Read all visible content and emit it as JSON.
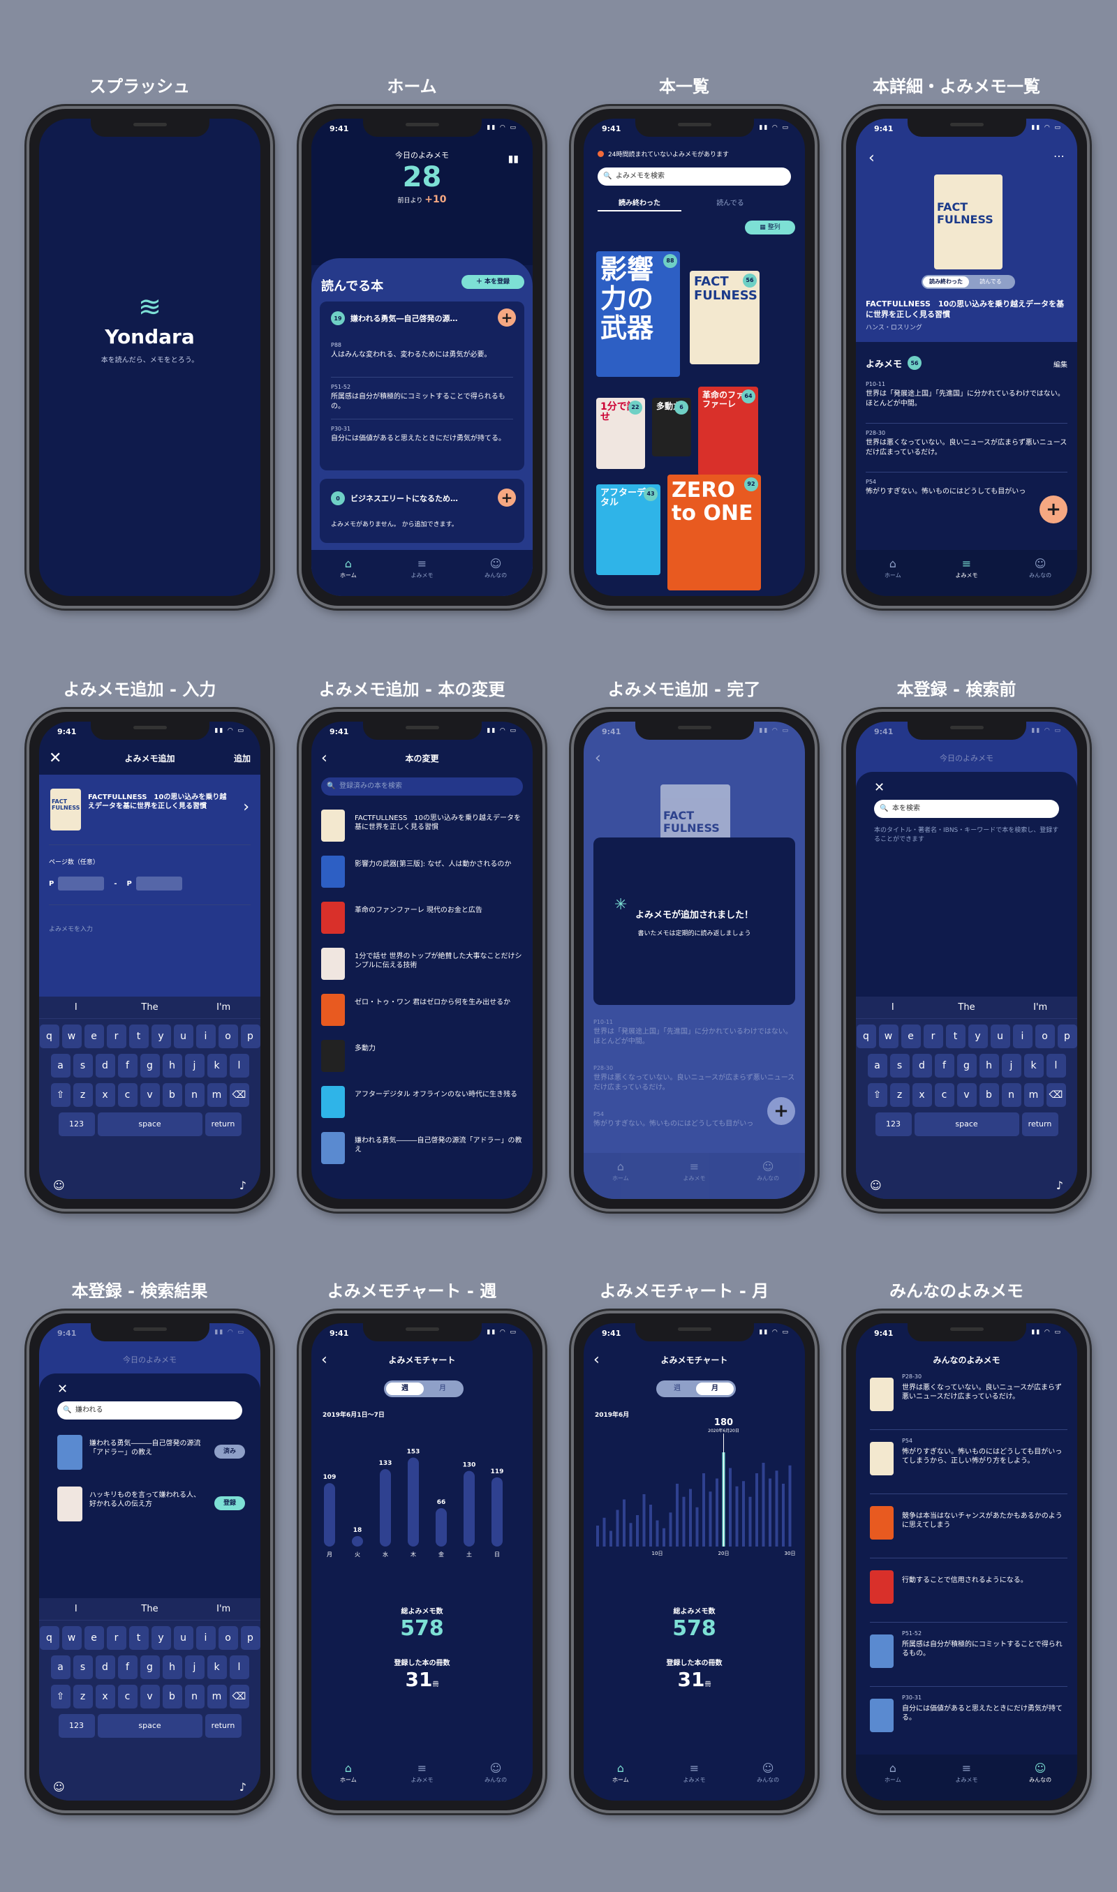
{
  "titles": [
    "スプラッシュ",
    "ホーム",
    "本一覧",
    "本詳細・よみメモ一覧",
    "よみメモ追加 - 入力",
    "よみメモ追加 - 本の変更",
    "よみメモ追加 - 完了",
    "本登録 - 検索前",
    "本登録 - 検索結果",
    "よみメモチャート - 週",
    "よみメモチャート - 月",
    "みんなのよみメモ"
  ],
  "time": "9:41",
  "splash": {
    "logo": "Yondara",
    "tagline": "本を読んだら、メモをとろう。"
  },
  "tabs": {
    "home": "ホーム",
    "memo": "よみメモ",
    "all": "みんなの"
  },
  "home": {
    "today_label": "今日のよみメモ",
    "today_count": "28",
    "prev_label": "前日より",
    "prev_delta": "+10",
    "reading": "読んでる本",
    "add_book": "＋ 本を登録",
    "book1": {
      "count": "19",
      "title": "嫌われる勇気―自己啓発の源…",
      "memos": [
        {
          "page": "P88",
          "text": "人はみんな変われる、変わるためには勇気が必要。"
        },
        {
          "page": "P51-52",
          "text": "所属感は自分が積極的にコミットすることで得られるもの。"
        },
        {
          "page": "P30-31",
          "text": "自分には価値があると思えたときにだけ勇気が持てる。"
        }
      ]
    },
    "book2": {
      "count": "0",
      "title": "ビジネスエリートになるため…",
      "empty": "よみメモがありません。 から追加できます。"
    }
  },
  "list": {
    "notice": "24時間読まれていないよみメモがあります",
    "search": "よみメモを検索",
    "tab1": "読み終わった",
    "tab2": "読んでる",
    "sort": "整列",
    "books": [
      {
        "t": "影響力の武器",
        "n": "88"
      },
      {
        "t": "FACT FULNESS",
        "n": "56"
      },
      {
        "t": "1分で話せ",
        "n": "22"
      },
      {
        "t": "多動力",
        "n": "6"
      },
      {
        "t": "革命のファンファーレ",
        "n": "64"
      },
      {
        "t": "アフターデジタル",
        "n": "43"
      },
      {
        "t": "ZERO to ONE",
        "n": "92"
      }
    ]
  },
  "detail": {
    "cover": "FACT FULNESS",
    "seg1": "読み終わった",
    "seg2": "読んでる",
    "title": "FACTFULLNESS　10の思い込みを乗り越えデータを基に世界を正しく見る習慣",
    "author": "ハンス・ロスリング",
    "memo_label": "よみメモ",
    "memo_count": "56",
    "edit": "編集",
    "memos": [
      {
        "page": "P10-11",
        "text": "世界は「発展途上国」「先進国」に分かれているわけではない。ほとんどが中間。"
      },
      {
        "page": "P28-30",
        "text": "世界は悪くなっていない。良いニュースが広まらず悪いニュースだけ広まっているだけ。"
      },
      {
        "page": "P54",
        "text": "怖がりすぎない。怖いものにはどうしても目がいっ"
      }
    ]
  },
  "add": {
    "close": "✕",
    "title": "よみメモ追加",
    "add": "追加",
    "book": "FACTFULLNESS　10の思い込みを乗り越えデータを基に世界を正しく見る習慣",
    "cover": "FACT FULNESS",
    "page_label": "ページ数（任意）",
    "p1": "P",
    "dash": "-",
    "p2": "P",
    "memo_ph": "よみメモを入力"
  },
  "keyboard": {
    "sug": [
      "I",
      "The",
      "I'm"
    ],
    "r1": [
      "q",
      "w",
      "e",
      "r",
      "t",
      "y",
      "u",
      "i",
      "o",
      "p"
    ],
    "r2": [
      "a",
      "s",
      "d",
      "f",
      "g",
      "h",
      "j",
      "k",
      "l"
    ],
    "r3": [
      "z",
      "x",
      "c",
      "v",
      "b",
      "n",
      "m"
    ],
    "num": "123",
    "space": "space",
    "ret": "return"
  },
  "change": {
    "title": "本の変更",
    "search": "登録済みの本を検索",
    "books": [
      "FACTFULLNESS　10の思い込みを乗り越えデータを基に世界を正しく見る習慣",
      "影響力の武器[第三版]: なぜ、人は動かされるのか",
      "革命のファンファーレ 現代のお金と広告",
      "1分で話せ 世界のトップが絶賛した大事なことだけシンプルに伝える技術",
      "ゼロ・トゥ・ワン 君はゼロから何を生み出せるか",
      "多動力",
      "アフターデジタル オフラインのない時代に生き残る",
      "嫌われる勇気―――自己啓発の源流「アドラー」の教え"
    ]
  },
  "done": {
    "title": "よみメモが追加されました！",
    "sub": "書いたメモは定期的に読み返しましょう",
    "cover": "FACT FULNESS",
    "memos": [
      {
        "page": "P10-11",
        "text": "世界は「発展途上国」「先進国」に分かれているわけではない。ほとんどが中間。"
      },
      {
        "page": "P28-30",
        "text": "世界は悪くなっていない。良いニュースが広まらず悪いニュースだけ広まっているだけ。"
      },
      {
        "page": "P54",
        "text": "怖がりすぎない。怖いものにはどうしても目がいっ"
      }
    ]
  },
  "reg": {
    "bg": "今日のよみメモ",
    "search": "本を検索",
    "help": "本のタイトル・著者名・IBNS・キーワードで本を検索し、登録することができます",
    "query": "嫌われる",
    "results": [
      {
        "t": "嫌われる勇気―――自己啓発の源流「アドラー」の教え",
        "btn": "済み"
      },
      {
        "t": "ハッキリものを言って嫌われる人、好かれる人の伝え方",
        "btn": "登録"
      }
    ]
  },
  "week": {
    "title": "よみメモチャート",
    "tab1": "週",
    "tab2": "月",
    "range": "2019年6月1日〜7日",
    "total_label": "総よみメモ数",
    "total": "578",
    "books_label": "登録した本の冊数",
    "books": "31",
    "unit": "冊"
  },
  "month": {
    "title": "よみメモチャート",
    "tab1": "週",
    "tab2": "月",
    "range": "2019年6月",
    "peak": "180",
    "peak_date": "2020年6月20日",
    "total_label": "総よみメモ数",
    "total": "578",
    "books_label": "登録した本の冊数",
    "books": "31",
    "unit": "冊",
    "ticks": [
      "10日",
      "20日",
      "30日"
    ]
  },
  "everyone": {
    "title": "みんなのよみメモ",
    "items": [
      {
        "page": "P28-30",
        "text": "世界は悪くなっていない。良いニュースが広まらず悪いニュースだけ広まっているだけ。"
      },
      {
        "page": "P54",
        "text": "怖がりすぎない。怖いものにはどうしても目がいってしまうから、正しい怖がり方をしよう。"
      },
      {
        "page": "",
        "text": "競争は本当はないチャンスがあたかもあるかのように思えてしまう"
      },
      {
        "page": "",
        "text": "行動することで信用されるようになる。"
      },
      {
        "page": "P51-52",
        "text": "所属感は自分が積極的にコミットすることで得られるもの。"
      },
      {
        "page": "P30-31",
        "text": "自分には価値があると思えたときにだけ勇気が持てる。"
      }
    ]
  },
  "chart_data": [
    {
      "type": "bar",
      "title": "よみメモチャート",
      "range": "2019年6月1日〜7日",
      "categories": [
        "月",
        "火",
        "水",
        "木",
        "金",
        "土",
        "日"
      ],
      "values": [
        109,
        18,
        133,
        153,
        66,
        130,
        119
      ]
    },
    {
      "type": "bar",
      "title": "よみメモチャート",
      "range": "2019年6月",
      "peak": 180,
      "peak_day": 20,
      "values": [
        40,
        55,
        30,
        70,
        90,
        45,
        60,
        100,
        80,
        50,
        35,
        65,
        120,
        95,
        110,
        75,
        140,
        105,
        130,
        180,
        150,
        115,
        125,
        95,
        140,
        160,
        130,
        145,
        120,
        155
      ]
    }
  ]
}
